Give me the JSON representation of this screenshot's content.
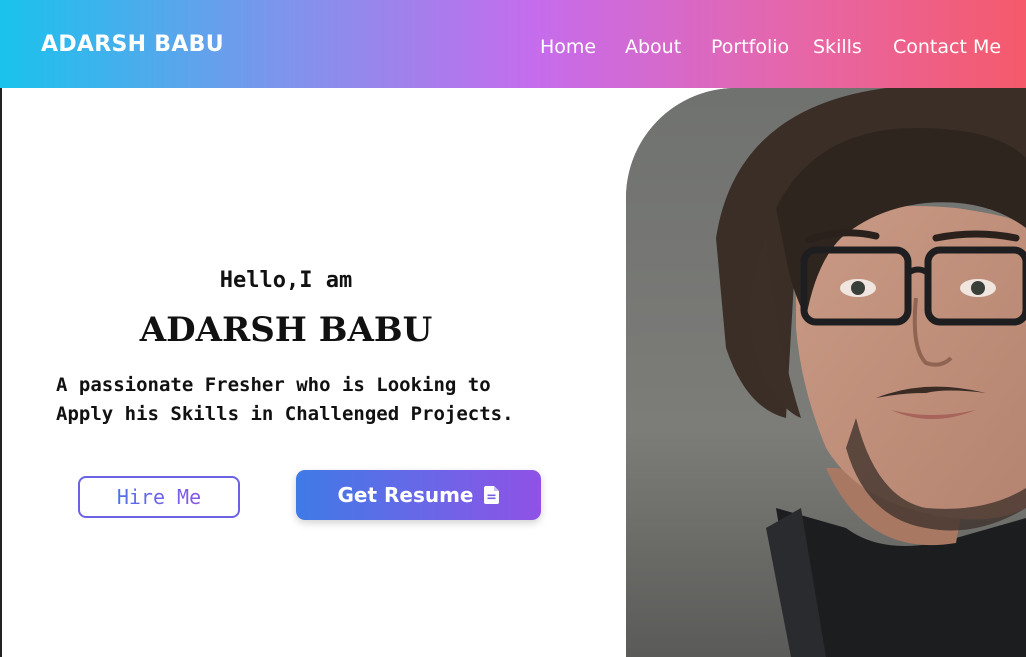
{
  "header": {
    "brand": "ADARSH BABU",
    "nav": [
      {
        "label": "Home"
      },
      {
        "label": "About"
      },
      {
        "label": "Portfolio"
      },
      {
        "label": "Skills"
      },
      {
        "label": "Contact Me"
      }
    ]
  },
  "hero": {
    "greeting": "Hello,I am",
    "name": "ADARSH BABU",
    "description_line1": "A passionate Fresher who is Looking to",
    "description_line2": "Apply his Skills in Challenged Projects.",
    "hire_button": "Hire Me",
    "resume_button": "Get Resume",
    "resume_icon": "file-icon"
  },
  "photo": {
    "alt": "portrait-photo"
  },
  "colors": {
    "gradient_start": "#19c3ec",
    "gradient_mid": "#c56ced",
    "gradient_end": "#f55a6a",
    "button_start": "#3f7ae6",
    "button_end": "#8f52e6"
  }
}
